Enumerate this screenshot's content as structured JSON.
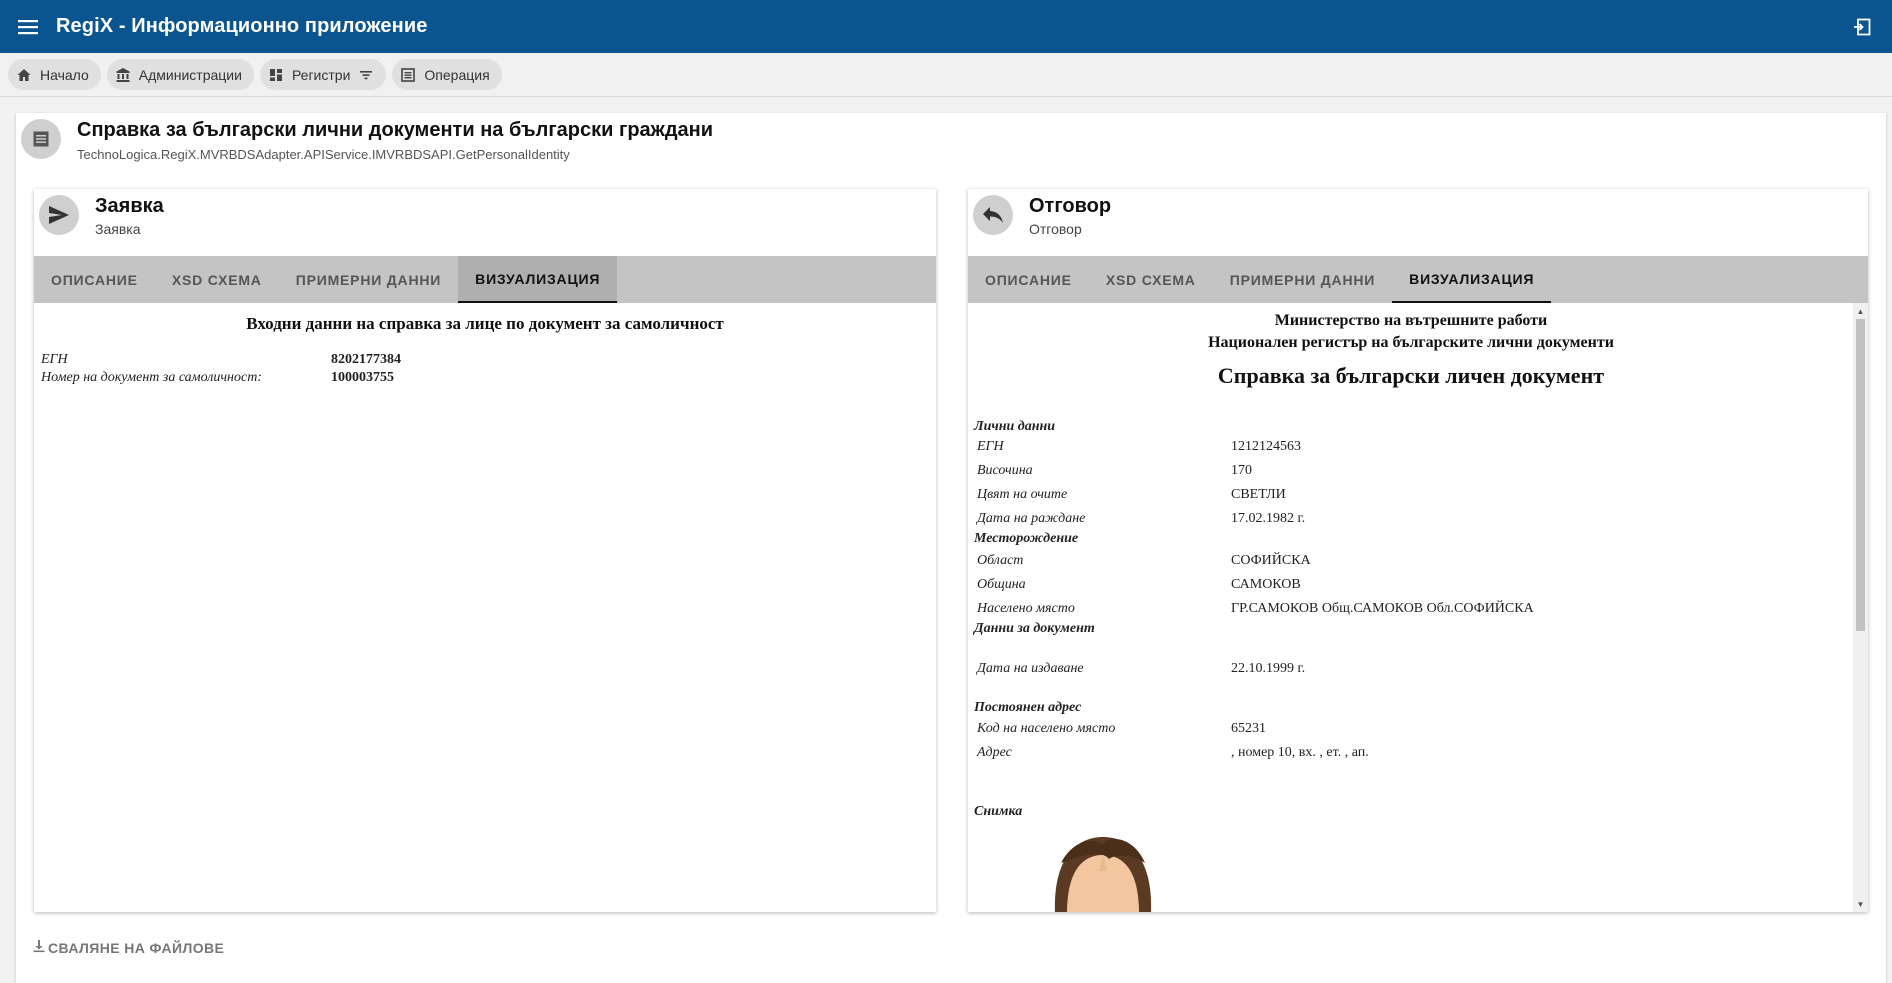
{
  "app": {
    "title": "RegiX - Информационно приложение"
  },
  "breadcrumb": [
    {
      "label": "Начало",
      "icon": "home-icon"
    },
    {
      "label": "Администрации",
      "icon": "institution-icon"
    },
    {
      "label": "Регистри",
      "icon": "dashboard-icon"
    },
    {
      "label": "Операция",
      "icon": "list-icon"
    }
  ],
  "page": {
    "title": "Справка за български лични документи на български граждани",
    "subtitle": "TechnoLogica.RegiX.MVRBDSAdapter.APIService.IMVRBDSAPI.GetPersonalIdentity"
  },
  "request_panel": {
    "title": "Заявка",
    "subtitle": "Заявка",
    "tabs": [
      "ОПИСАНИЕ",
      "XSD СХЕМА",
      "ПРИМЕРНИ ДАННИ",
      "ВИЗУАЛИЗАЦИЯ"
    ],
    "active_tab": "ВИЗУАЛИЗАЦИЯ",
    "viz": {
      "title": "Входни данни на справка за лице по документ за самоличност",
      "rows": [
        {
          "label": "ЕГН",
          "value": "8202177384"
        },
        {
          "label": "Номер на документ за самоличност:",
          "value": "100003755"
        }
      ]
    }
  },
  "response_panel": {
    "title": "Отговор",
    "subtitle": "Отговор",
    "tabs": [
      "ОПИСАНИЕ",
      "XSD СХЕМА",
      "ПРИМЕРНИ ДАННИ",
      "ВИЗУАЛИЗАЦИЯ"
    ],
    "active_tab": "ВИЗУАЛИЗАЦИЯ",
    "viz": {
      "ministry": "Министерство на вътрешните работи",
      "registry": "Национален регистър на българските лични документи",
      "title": "Справка за български личен документ",
      "personal_heading": "Лични данни",
      "egn_label": "ЕГН",
      "egn_value": "1212124563",
      "height_label": "Височина",
      "height_value": "170",
      "eyes_label": "Цвят на очите",
      "eyes_value": "СВЕТЛИ",
      "dob_label": "Дата на раждане",
      "dob_value": "17.02.1982 г.",
      "birthplace_heading": "Месторождение",
      "region_label": "Област",
      "region_value": "СОФИЙСКА",
      "municipality_label": "Община",
      "municipality_value": "САМОКОВ",
      "settlement_label": "Населено място",
      "settlement_value": "ГР.САМОКОВ Общ.САМОКОВ Обл.СОФИЙСКА",
      "document_heading": "Данни за документ",
      "issue_label": "Дата на издаване",
      "issue_value": "22.10.1999 г.",
      "address_heading": "Постоянен адрес",
      "code_label": "Код на населено място",
      "code_value": "65231",
      "address_label": "Адрес",
      "address_value": ", номер 10, вх. , ет. , ап.",
      "photo_heading": "Снимка"
    }
  },
  "download": {
    "label": "СВАЛЯНЕ НА ФАЙЛОВЕ"
  },
  "colors": {
    "appbar": "#0a5590",
    "tabs_bg": "#c4c4c4",
    "active_tab_bg": "#afafaf"
  }
}
